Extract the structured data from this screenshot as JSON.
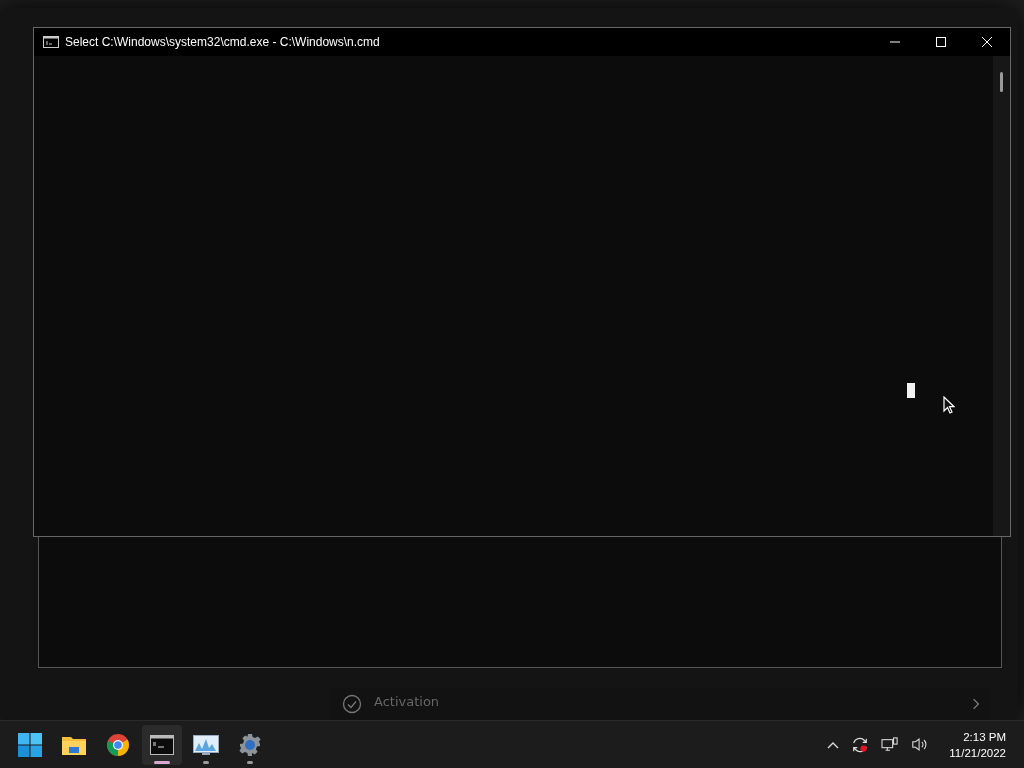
{
  "settings_window": {
    "activation": {
      "title": "Activation"
    }
  },
  "cmd_window": {
    "title": "Select C:\\Windows\\system32\\cmd.exe - C:\\Windows\\n.cmd",
    "cursor_visible": true
  },
  "taskbar": {
    "apps": [
      {
        "kind": "start",
        "running": false,
        "selected": false
      },
      {
        "kind": "folder",
        "running": false,
        "selected": false
      },
      {
        "kind": "browser",
        "running": false,
        "selected": false
      },
      {
        "kind": "console",
        "running": true,
        "selected": true
      },
      {
        "kind": "monitor",
        "running": true,
        "selected": false
      },
      {
        "kind": "settings",
        "running": true,
        "selected": false
      }
    ],
    "tray": {
      "time": "2:13 PM",
      "date": "11/21/2022"
    }
  }
}
